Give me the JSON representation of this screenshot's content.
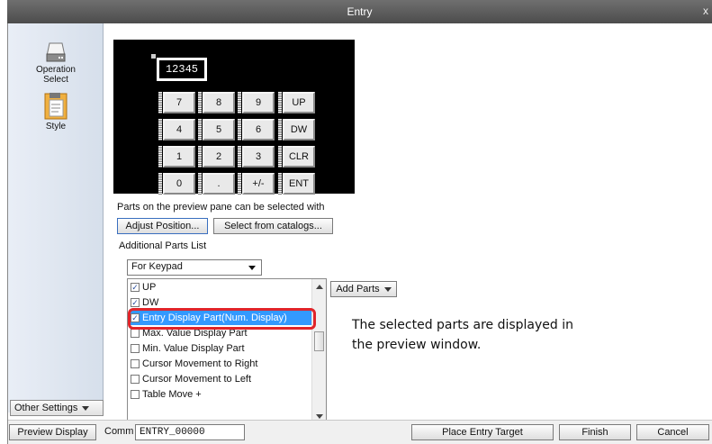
{
  "window": {
    "title": "Entry",
    "close_glyph": "x"
  },
  "sidebar": {
    "items": [
      {
        "label": "Operation\nSelect",
        "icon": "operation-select-icon"
      },
      {
        "label": "Style",
        "icon": "style-icon"
      }
    ],
    "other_settings_label": "Other Settings"
  },
  "preview": {
    "display_value": "12345",
    "keys": [
      "7",
      "8",
      "9",
      "UP",
      "4",
      "5",
      "6",
      "DW",
      "1",
      "2",
      "3",
      "CLR",
      "0",
      ".",
      "+/-",
      "ENT"
    ]
  },
  "main": {
    "hint_text": "Parts on the preview pane can be selected with",
    "adjust_position_label": "Adjust Position...",
    "select_from_catalogs_label": "Select from catalogs...",
    "additional_parts_label": "Additional Parts List",
    "parts_filter_value": "For Keypad",
    "parts_list": [
      {
        "label": "UP",
        "checked": true
      },
      {
        "label": "DW",
        "checked": true
      },
      {
        "label": "Entry Display Part(Num. Display)",
        "checked": true,
        "selected": true
      },
      {
        "label": "Max. Value Display Part",
        "checked": false
      },
      {
        "label": "Min. Value Display Part",
        "checked": false
      },
      {
        "label": "Cursor Movement to Right",
        "checked": false
      },
      {
        "label": "Cursor Movement to Left",
        "checked": false
      },
      {
        "label": "Table Move +",
        "checked": false
      }
    ],
    "add_parts_label": "Add Parts",
    "annotation_line1": "The selected parts are displayed in",
    "annotation_line2": "the preview window."
  },
  "bottom": {
    "preview_display_label": "Preview Display",
    "comm_label": "Comm",
    "comm_value": "ENTRY_00000",
    "place_entry_target_label": "Place Entry Target",
    "finish_label": "Finish",
    "cancel_label": "Cancel"
  },
  "colors": {
    "highlight": "#e0242a",
    "selection": "#3399ff",
    "titlebar": "#5a5a5a"
  }
}
